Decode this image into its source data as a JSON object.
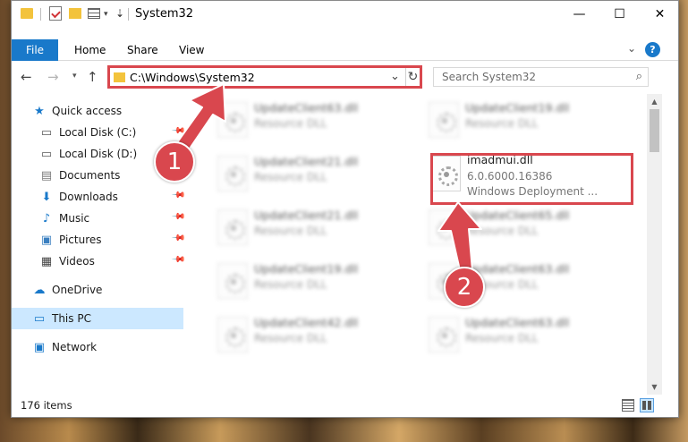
{
  "window": {
    "title": "System32",
    "controls": {
      "minimize": "—",
      "maximize": "☐",
      "close": "✕"
    }
  },
  "ribbon": {
    "tabs": [
      {
        "label": "File"
      },
      {
        "label": "Home"
      },
      {
        "label": "Share"
      },
      {
        "label": "View"
      }
    ],
    "help": "?"
  },
  "nav": {
    "address_path": "C:\\Windows\\System32",
    "search_placeholder": "Search System32"
  },
  "sidebar": {
    "items": [
      {
        "label": "Quick access"
      },
      {
        "label": "Local Disk (C:)"
      },
      {
        "label": "Local Disk (D:)"
      },
      {
        "label": "Documents"
      },
      {
        "label": "Downloads"
      },
      {
        "label": "Music"
      },
      {
        "label": "Pictures"
      },
      {
        "label": "Videos"
      },
      {
        "label": "OneDrive"
      },
      {
        "label": "This PC"
      },
      {
        "label": "Network"
      }
    ]
  },
  "files": [
    {
      "name": "UpdateClient63.dll",
      "type": "Resource DLL"
    },
    {
      "name": "UpdateClient19.dll",
      "type": "Resource DLL"
    },
    {
      "name": "UpdateClient21.dll",
      "type": "Resource DLL"
    },
    {
      "name": "imadmui.dll",
      "type": "6.0.6000.16386",
      "desc": "Windows Deployment ..."
    },
    {
      "name": "UpdateClient21.dll",
      "type": "Resource DLL"
    },
    {
      "name": "UpdateClient65.dll",
      "type": "Resource DLL"
    },
    {
      "name": "UpdateClient19.dll",
      "type": "Resource DLL"
    },
    {
      "name": "UpdateClient63.dll",
      "type": "Resource DLL"
    },
    {
      "name": "UpdateClient42.dll",
      "type": "Resource DLL"
    },
    {
      "name": "UpdateClient63.dll",
      "type": "Resource DLL"
    }
  ],
  "status": {
    "item_count": "176 items"
  },
  "annotations": {
    "step1": "1",
    "step2": "2",
    "color": "#d9474e"
  }
}
